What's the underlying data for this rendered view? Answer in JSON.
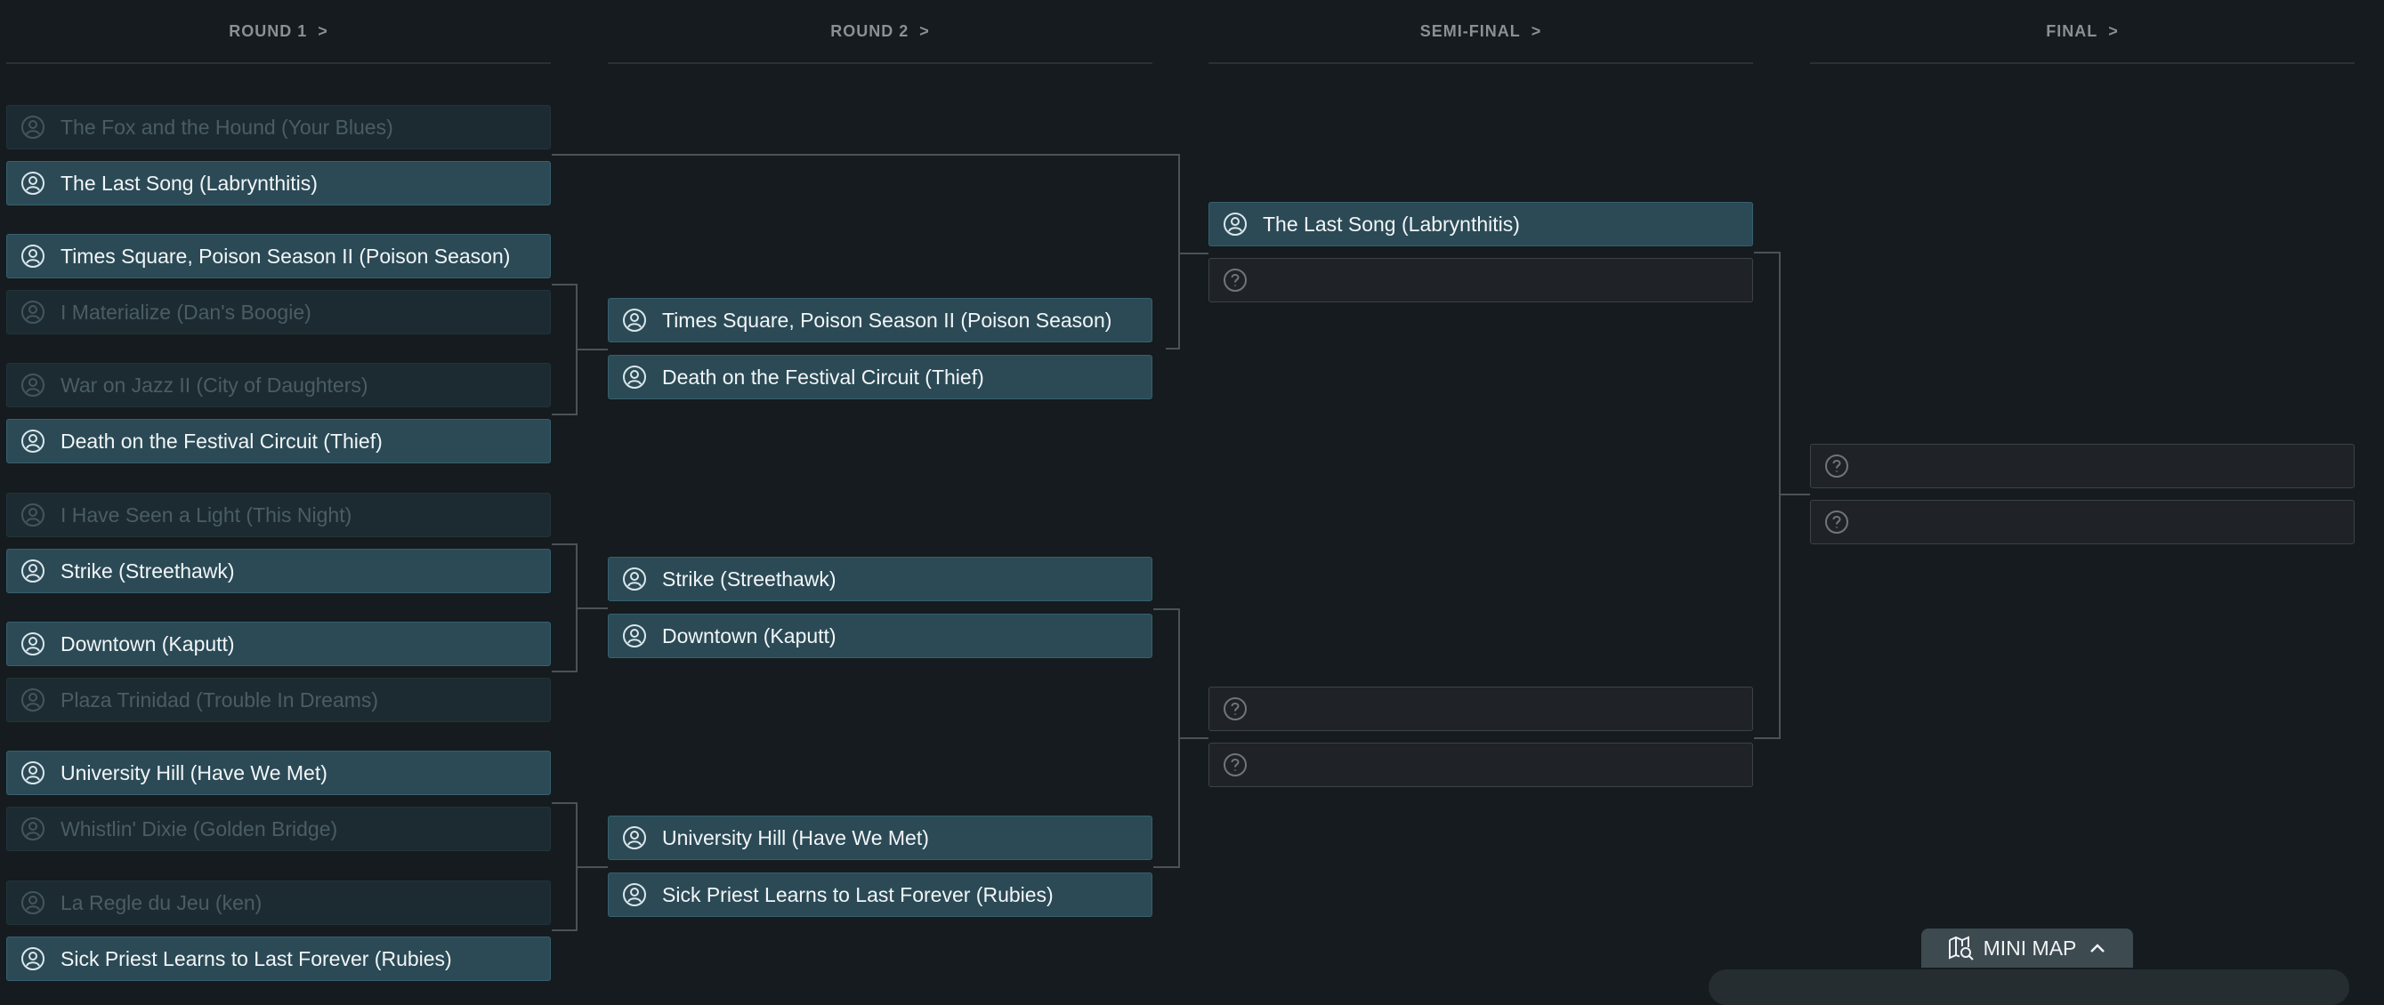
{
  "rounds": [
    {
      "label": "ROUND 1",
      "chevron": ">"
    },
    {
      "label": "ROUND 2",
      "chevron": ">"
    },
    {
      "label": "SEMI-FINAL",
      "chevron": ">"
    },
    {
      "label": "FINAL",
      "chevron": ">"
    }
  ],
  "round1": [
    {
      "title": "The Fox and the Hound (Your Blues)",
      "state": "lose"
    },
    {
      "title": "The Last Song (Labrynthitis)",
      "state": "win"
    },
    {
      "title": "Times Square, Poison Season II (Poison Season)",
      "state": "win"
    },
    {
      "title": "I Materialize (Dan's Boogie)",
      "state": "lose"
    },
    {
      "title": "War on Jazz II (City of Daughters)",
      "state": "lose"
    },
    {
      "title": "Death on the Festival Circuit (Thief)",
      "state": "win"
    },
    {
      "title": "I Have Seen a Light (This Night)",
      "state": "lose"
    },
    {
      "title": "Strike (Streethawk)",
      "state": "win"
    },
    {
      "title": "Downtown (Kaputt)",
      "state": "win"
    },
    {
      "title": "Plaza Trinidad (Trouble In Dreams)",
      "state": "lose"
    },
    {
      "title": "University Hill (Have We Met)",
      "state": "win"
    },
    {
      "title": "Whistlin' Dixie (Golden Bridge)",
      "state": "lose"
    },
    {
      "title": "La Regle du Jeu (ken)",
      "state": "lose"
    },
    {
      "title": "Sick Priest Learns to Last Forever (Rubies)",
      "state": "win"
    }
  ],
  "round2": [
    {
      "title": "Times Square, Poison Season II (Poison Season)",
      "state": "win"
    },
    {
      "title": "Death on the Festival Circuit (Thief)",
      "state": "win"
    },
    {
      "title": "Strike (Streethawk)",
      "state": "win"
    },
    {
      "title": "Downtown (Kaputt)",
      "state": "win"
    },
    {
      "title": "University Hill (Have We Met)",
      "state": "win"
    },
    {
      "title": "Sick Priest Learns to Last Forever (Rubies)",
      "state": "win"
    }
  ],
  "semifinal": [
    {
      "title": "The Last Song (Labrynthitis)",
      "state": "win"
    },
    {
      "title": "",
      "state": "empty"
    },
    {
      "title": "",
      "state": "empty"
    },
    {
      "title": "",
      "state": "empty"
    }
  ],
  "final": [
    {
      "title": "",
      "state": "empty"
    },
    {
      "title": "",
      "state": "empty"
    }
  ],
  "minimap": {
    "label": "MINI MAP"
  }
}
